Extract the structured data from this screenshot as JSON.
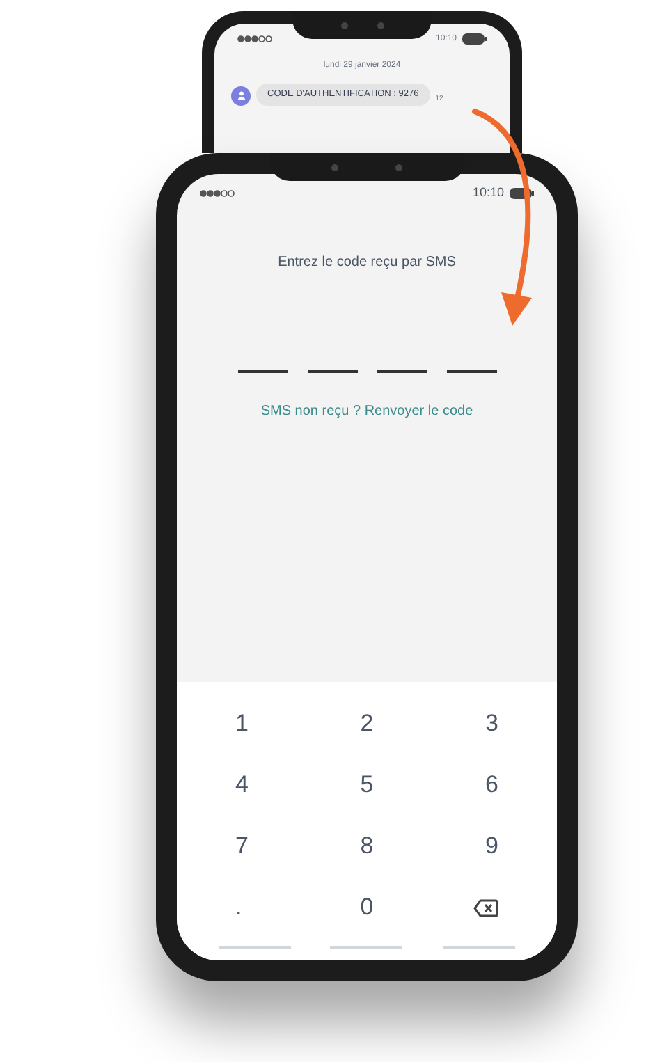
{
  "back_phone": {
    "status_time": "10:10",
    "date": "lundi 29 janvier 2024",
    "message": {
      "text": "CODE D'AUTHENTIFICATION : 9276",
      "time": "12"
    }
  },
  "front_phone": {
    "status_time": "10:10",
    "prompt": "Entrez le code reçu par SMS",
    "code_slots": [
      {
        "filled": false
      },
      {
        "filled": false
      },
      {
        "filled": false
      },
      {
        "filled": false
      }
    ],
    "resend_link": "SMS non reçu ? Renvoyer le code",
    "keypad": [
      {
        "kind": "digit",
        "label": "1"
      },
      {
        "kind": "digit",
        "label": "2"
      },
      {
        "kind": "digit",
        "label": "3"
      },
      {
        "kind": "digit",
        "label": "4"
      },
      {
        "kind": "digit",
        "label": "5"
      },
      {
        "kind": "digit",
        "label": "6"
      },
      {
        "kind": "digit",
        "label": "7"
      },
      {
        "kind": "digit",
        "label": "8"
      },
      {
        "kind": "digit",
        "label": "9"
      },
      {
        "kind": "digit",
        "label": "."
      },
      {
        "kind": "digit",
        "label": "0"
      },
      {
        "kind": "backspace"
      }
    ]
  }
}
